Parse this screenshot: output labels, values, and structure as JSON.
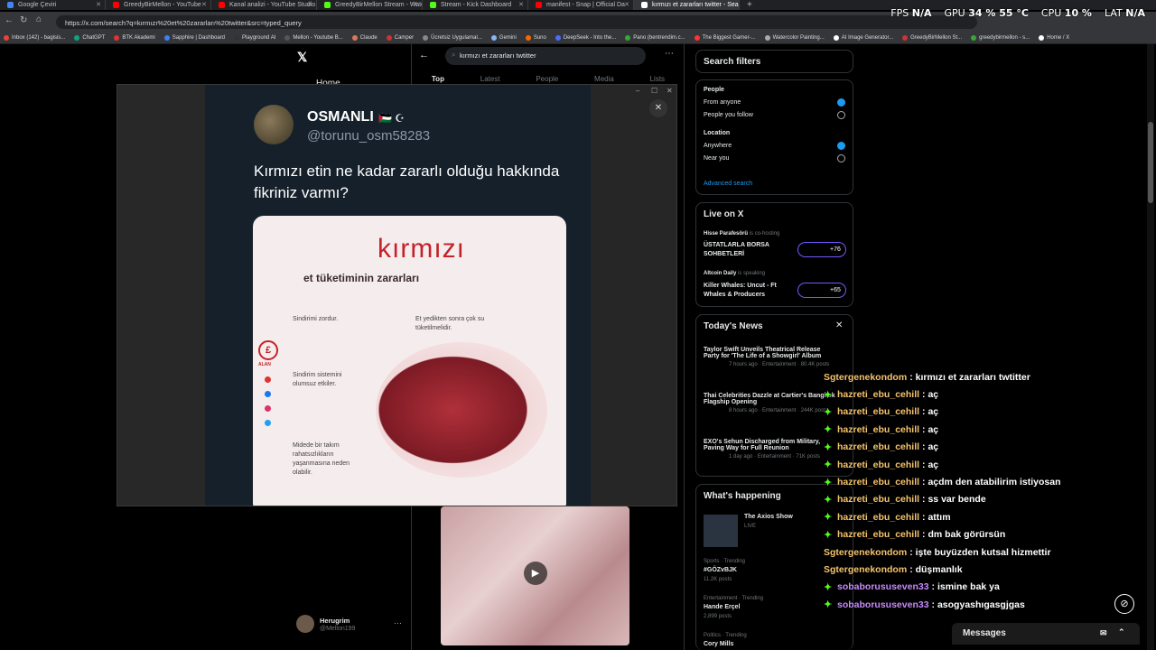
{
  "browser": {
    "tabs": [
      {
        "label": "Google Çeviri",
        "color": "#4285f4"
      },
      {
        "label": "GreedyBirMellon - YouTube",
        "color": "#ff0000"
      },
      {
        "label": "Kanal analizi - YouTube Studio",
        "color": "#ff0000"
      },
      {
        "label": "GreedyBirMellon Stream - Watch",
        "color": "#53fc18"
      },
      {
        "label": "Stream - Kick Dashboard",
        "color": "#53fc18"
      },
      {
        "label": "manifest - Snap | Official Da",
        "color": "#ff0000"
      },
      {
        "label": "kırmızı et zararları twitter - Sear",
        "color": "#ffffff"
      }
    ],
    "url": "https://x.com/search?q=kırmızı%20et%20zararları%20twitter&src=typed_query",
    "bookmarks": [
      {
        "label": "Inbox (142) - bagisis...",
        "color": "#ea4335"
      },
      {
        "label": "ChatGPT",
        "color": "#10a37f"
      },
      {
        "label": "BTK Akademi",
        "color": "#d33"
      },
      {
        "label": "Sapphire | Dashboard",
        "color": "#3b82f6"
      },
      {
        "label": "Playground AI",
        "color": "#333"
      },
      {
        "label": "Mellon - Youtube B...",
        "color": "#555"
      },
      {
        "label": "Claude",
        "color": "#d97757"
      },
      {
        "label": "Camper",
        "color": "#c33"
      },
      {
        "label": "Ücretsiz Uygulamal...",
        "color": "#888"
      },
      {
        "label": "Gemini",
        "color": "#8ab4f8"
      },
      {
        "label": "Suno",
        "color": "#f60"
      },
      {
        "label": "DeepSeek - Into the...",
        "color": "#4d6bfe"
      },
      {
        "label": "Pano (bentrendim.c...",
        "color": "#3a3"
      },
      {
        "label": "The Biggest Gamer-...",
        "color": "#f33"
      },
      {
        "label": "Watercolor Painting...",
        "color": "#aaa"
      },
      {
        "label": "AI Image Generator...",
        "color": "#fff"
      },
      {
        "label": "GreedyBirMellon St...",
        "color": "#c33"
      },
      {
        "label": "greedybirmellon - s...",
        "color": "#3a3"
      },
      {
        "label": "Home / X",
        "color": "#fff"
      }
    ]
  },
  "hud": {
    "fps_label": "FPS",
    "fps": "N/A",
    "gpu_label": "GPU",
    "gpu": "34 % 55 °C",
    "cpu_label": "CPU",
    "cpu": "10 %",
    "lat_label": "LAT",
    "lat": "N/A"
  },
  "x": {
    "nav_home": "Home",
    "search_value": "kırmızı et zararları twtitter",
    "tabs": [
      "Top",
      "Latest",
      "People",
      "Media",
      "Lists"
    ],
    "profile_name": "Herugrim",
    "profile_handle": "@Mellon199"
  },
  "filters": {
    "title": "Search filters",
    "people_label": "People",
    "from_anyone": "From anyone",
    "people_you_follow": "People you follow",
    "location_label": "Location",
    "anywhere": "Anywhere",
    "near_you": "Near you",
    "advanced": "Advanced search"
  },
  "live": {
    "title": "Live on X",
    "items": [
      {
        "host": "Hisse Parafesörü",
        "status": "is co-hosting",
        "title1": "ÜSTATLARLA BORSA",
        "title2": "SOHBETLERİ",
        "count": "+76"
      },
      {
        "host": "Altcoin Daily",
        "status": "is speaking",
        "title1": "Killer Whales: Uncut - Ft",
        "title2": "Whales & Producers",
        "count": "+65"
      }
    ]
  },
  "news": {
    "title": "Today's News",
    "items": [
      {
        "h1": "Taylor Swift Unveils Theatrical Release",
        "h2": "Party for 'The Life of a Showgirl' Album",
        "meta": "7 hours ago · Entertainment · 80.4K posts"
      },
      {
        "h1": "Thai Celebrities Dazzle at Cartier's Bangkok",
        "h2": "Flagship Opening",
        "meta": "8 hours ago · Entertainment · 244K posts"
      },
      {
        "h1": "EXO's Sehun Discharged from Military,",
        "h2": "Paving Way for Full Reunion",
        "meta": "1 day ago · Entertainment · 71K posts"
      }
    ]
  },
  "happening": {
    "title": "What's happening",
    "show": "The Axios Show",
    "live": "LIVE",
    "trends": [
      {
        "cat": "Sports · Trending",
        "name": "#GÖZvBJK",
        "posts": "11.2K posts"
      },
      {
        "cat": "Entertainment · Trending",
        "name": "Hande Erçel",
        "posts": "2,899 posts"
      },
      {
        "cat": "Politics · Trending",
        "name": "Cory Mills",
        "posts": ""
      }
    ]
  },
  "modal_tweet": {
    "name": "OSMANLI",
    "handle": "@torunu_osm58283",
    "text": "Kırmızı etin ne kadar zararlı olduğu hakkında fikriniz varmı?",
    "card_title1": "kırmızı",
    "card_title2": "et tüketiminin zararları",
    "card_lines": [
      "Sindirimi zordur.",
      "Et yedikten sonra çok su tüketilmelidir.",
      "Sindirim sistemini olumsuz etkiler.",
      "Midede bir takım rahatsızlıkların yaşanmasına neden olabilir."
    ],
    "brand": "ALAN"
  },
  "chat": {
    "messages": [
      {
        "nick": "Sgtergenekondom",
        "text": "kırmızı et zararları twtitter",
        "color": "#f5c36b",
        "badge": false
      },
      {
        "nick": "hazreti_ebu_cehill",
        "text": "aç",
        "color": "#f5c36b",
        "badge": true
      },
      {
        "nick": "hazreti_ebu_cehill",
        "text": "aç",
        "color": "#f5c36b",
        "badge": true
      },
      {
        "nick": "hazreti_ebu_cehill",
        "text": "aç",
        "color": "#f5c36b",
        "badge": true
      },
      {
        "nick": "hazreti_ebu_cehill",
        "text": "aç",
        "color": "#f5c36b",
        "badge": true
      },
      {
        "nick": "hazreti_ebu_cehill",
        "text": "aç",
        "color": "#f5c36b",
        "badge": true
      },
      {
        "nick": "hazreti_ebu_cehill",
        "text": "açdm den atabilirim istiyosan",
        "color": "#f5c36b",
        "badge": true
      },
      {
        "nick": "hazreti_ebu_cehill",
        "text": "ss var bende",
        "color": "#f5c36b",
        "badge": true
      },
      {
        "nick": "hazreti_ebu_cehill",
        "text": "attım",
        "color": "#f5c36b",
        "badge": true
      },
      {
        "nick": "hazreti_ebu_cehill",
        "text": "dm bak görürsün",
        "color": "#f5c36b",
        "badge": true
      },
      {
        "nick": "Sgtergenekondom",
        "text": "işte buyüzden kutsal hizmettir",
        "color": "#f5c36b",
        "badge": false
      },
      {
        "nick": "Sgtergenekondom",
        "text": "düşmanlık",
        "color": "#f5c36b",
        "badge": false
      },
      {
        "nick": "sobaborususeven33",
        "text": "ismine bak ya",
        "color": "#c58af9",
        "badge": true
      },
      {
        "nick": "sobaborususeven33",
        "text": "asogyashıgasgjgas",
        "color": "#c58af9",
        "badge": true
      }
    ],
    "messages_bar": "Messages"
  }
}
